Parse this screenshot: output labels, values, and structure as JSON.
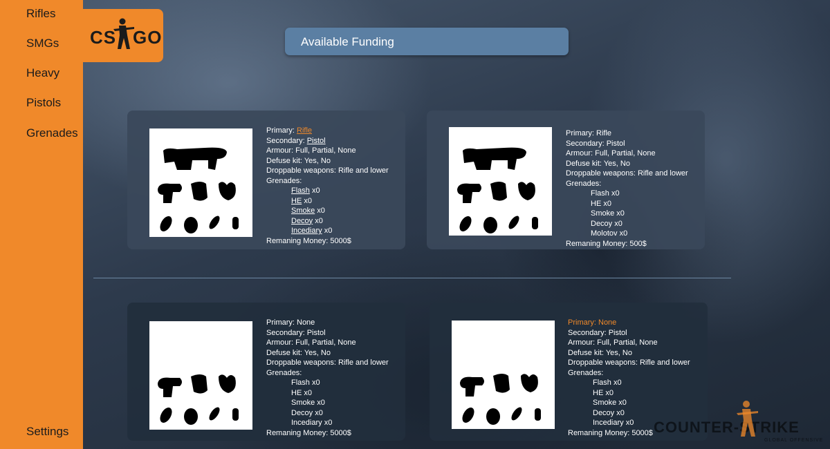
{
  "sidebar": {
    "items": [
      {
        "label": "Rifles"
      },
      {
        "label": "SMGs"
      },
      {
        "label": "Heavy"
      },
      {
        "label": "Pistols"
      },
      {
        "label": "Grenades"
      }
    ],
    "settings_label": "Settings"
  },
  "logo": {
    "left": "CS",
    "right": "GO",
    "icon": "soldier-icon"
  },
  "funding": {
    "label": "Available Funding"
  },
  "colors": {
    "accent": "#f0892a",
    "funding_bar": "#5b7fa3",
    "divider": "#6d88a3"
  },
  "loadouts": [
    {
      "primary_prefix": "Primary: ",
      "primary_value": "Rifle",
      "secondary_prefix": "Secondary: ",
      "secondary_value": "Pistol",
      "armour": "Armour: Full, Partial, None",
      "defuse": "Defuse kit: Yes, No",
      "droppable": "Droppable weapons: Rifle and lower",
      "grenades_label": "Grenades:",
      "grenades": [
        {
          "name": "Flash",
          "count": " x0"
        },
        {
          "name": "HE",
          "count": " x0"
        },
        {
          "name": "Smoke",
          "count": " x0"
        },
        {
          "name": "Decoy",
          "count": " x0"
        },
        {
          "name": "Incediary",
          "count": " x0"
        }
      ],
      "money": "Remaning Money: 5000$"
    },
    {
      "primary": "Primary: Rifle",
      "secondary": "Secondary: Pistol",
      "armour": "Armour: Full, Partial, None",
      "defuse": "Defuse kit: Yes, No",
      "droppable": "Droppable weapons: Rifle and lower",
      "grenades_label": "Grenades:",
      "grenades": [
        "Flash x0",
        "HE x0",
        "Smoke x0",
        "Decoy x0",
        "Molotov x0"
      ],
      "money": "Remaning Money: 500$"
    },
    {
      "primary": "Primary: None",
      "secondary": "Secondary: Pistol",
      "armour": "Armour: Full, Partial, None",
      "defuse": "Defuse kit: Yes, No",
      "droppable": "Droppable weapons: Rifle and lower",
      "grenades_label": "Grenades:",
      "grenades": [
        "Flash x0",
        "HE x0",
        "Smoke x0",
        "Decoy x0",
        "Incediary x0"
      ],
      "money": "Remaning Money: 5000$"
    },
    {
      "primary": "Primary: None",
      "secondary": "Secondary: Pistol",
      "armour": "Armour: Full, Partial, None",
      "defuse": "Defuse kit: Yes, No",
      "droppable": "Droppable weapons: Rifle and lower",
      "grenades_label": "Grenades:",
      "grenades": [
        "Flash x0",
        "HE x0",
        "Smoke x0",
        "Decoy x0",
        "Incediary x0"
      ],
      "money": "Remaning Money: 5000$"
    }
  ],
  "watermark": {
    "title": "COUNTER-STRIKE",
    "subtitle": "GLOBAL OFFENSIVE"
  }
}
